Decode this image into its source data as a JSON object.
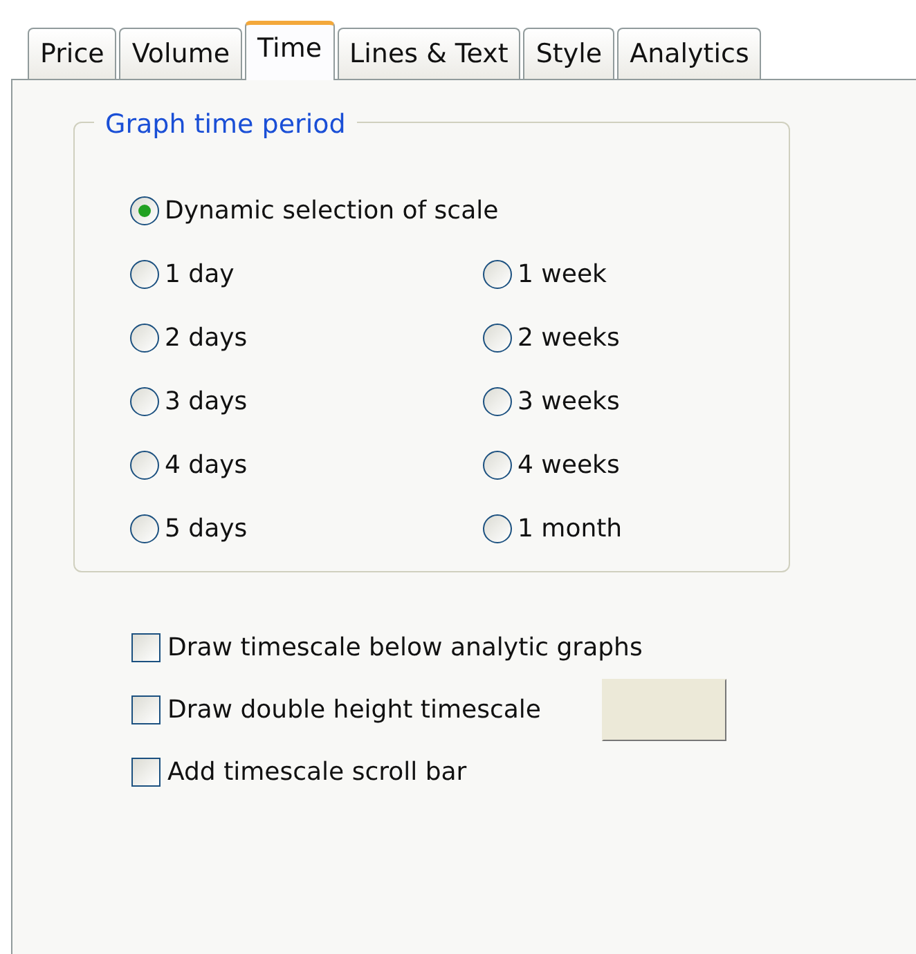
{
  "tabs": [
    {
      "label": "Price",
      "selected": false
    },
    {
      "label": "Volume",
      "selected": false
    },
    {
      "label": "Time",
      "selected": true
    },
    {
      "label": "Lines & Text",
      "selected": false
    },
    {
      "label": "Style",
      "selected": false
    },
    {
      "label": "Analytics",
      "selected": false
    }
  ],
  "time_period": {
    "title": "Graph time period",
    "dynamic_option": {
      "label": "Dynamic selection of scale",
      "selected": true
    },
    "left_options": [
      {
        "label": "1 day",
        "selected": false
      },
      {
        "label": "2 days",
        "selected": false
      },
      {
        "label": "3 days",
        "selected": false
      },
      {
        "label": "4 days",
        "selected": false
      },
      {
        "label": "5 days",
        "selected": false
      }
    ],
    "right_options": [
      {
        "label": "1 week",
        "selected": false
      },
      {
        "label": "2 weeks",
        "selected": false
      },
      {
        "label": "3 weeks",
        "selected": false
      },
      {
        "label": "4 weeks",
        "selected": false
      },
      {
        "label": "1 month",
        "selected": false
      }
    ]
  },
  "checkboxes": [
    {
      "label": "Draw timescale below analytic graphs",
      "checked": false
    },
    {
      "label": "Draw double height timescale",
      "checked": false
    },
    {
      "label": "Add timescale scroll bar",
      "checked": false
    }
  ]
}
